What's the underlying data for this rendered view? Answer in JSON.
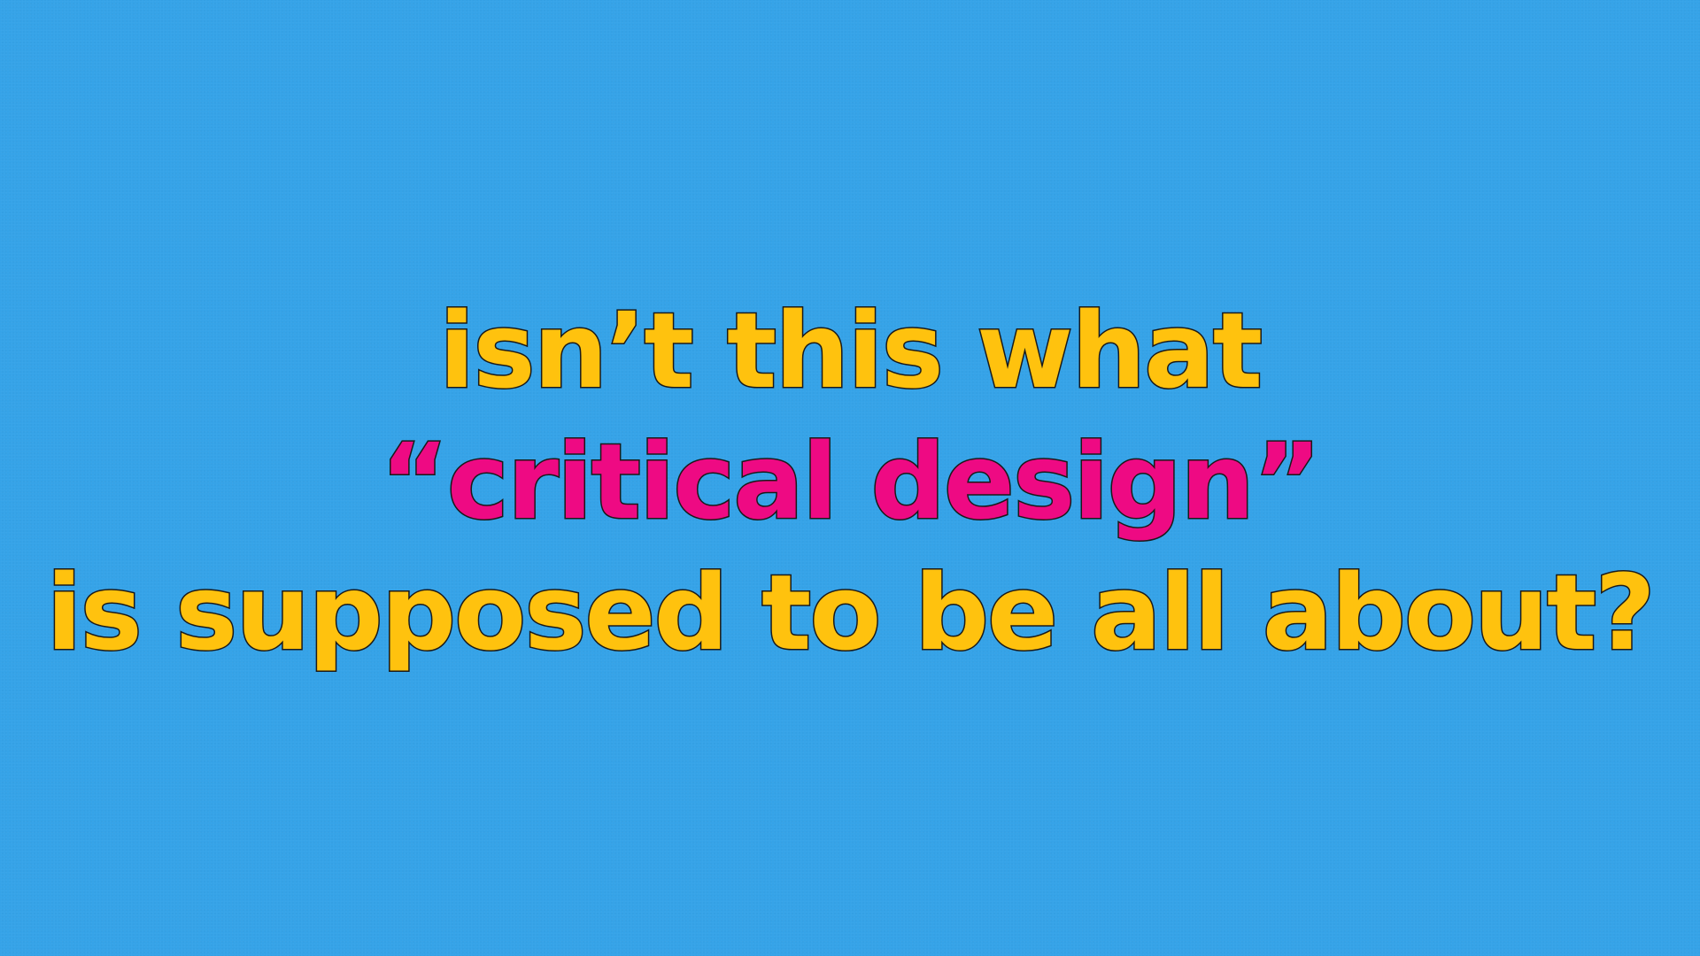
{
  "slide": {
    "background_color": "#35a3e8",
    "lines": [
      {
        "text": "isn’t this what",
        "color": "#ffc20e"
      },
      {
        "text": "“critical design”",
        "color": "#ee0a83"
      },
      {
        "text": "is supposed to be all about?",
        "color": "#ffc20e"
      }
    ],
    "outline_color": "#1a1a1a"
  }
}
